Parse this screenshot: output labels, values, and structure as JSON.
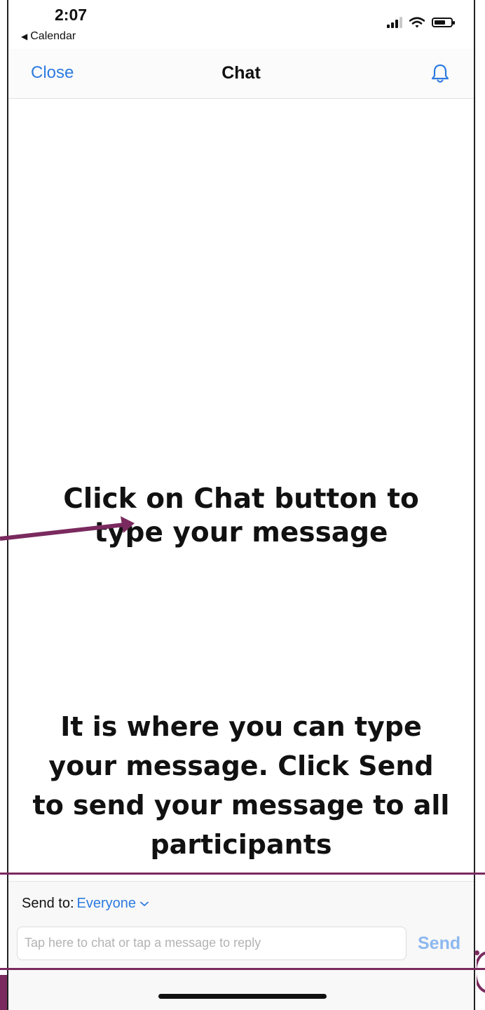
{
  "status_bar": {
    "time": "2:07",
    "back_app": "Calendar",
    "icons": [
      "cellular-signal-icon",
      "wifi-icon",
      "battery-icon"
    ]
  },
  "nav": {
    "close_label": "Close",
    "title": "Chat",
    "bell_icon": "bell-icon"
  },
  "annotations": {
    "chat_button_note": "Click on Chat button to type your message",
    "input_note": "It is where you can type your message. Click Send to send your message to all participants"
  },
  "footer": {
    "send_to_label": "Send to:",
    "send_to_value": "Everyone",
    "input_placeholder": "Tap here to chat or tap a message to reply",
    "send_label": "Send"
  },
  "colors": {
    "accent_blue": "#2d7be0",
    "send_disabled": "#8db8ef",
    "annotation_purple": "#7a2a5e"
  }
}
